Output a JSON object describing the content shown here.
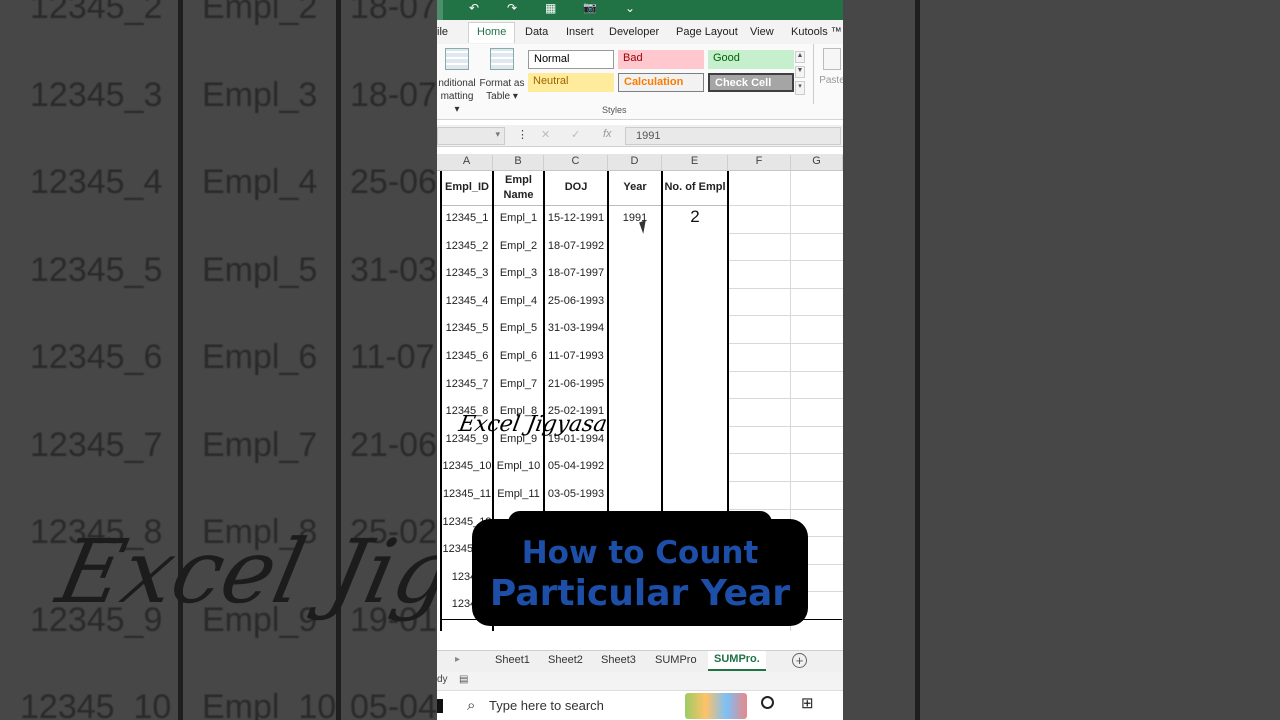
{
  "qat": {
    "undo": "↶",
    "redo": "↷",
    "table": "▦",
    "camera": "📷",
    "more": "⌄"
  },
  "ribbon_tabs": [
    "ile",
    "Home",
    "Data",
    "Insert",
    "Developer",
    "Page Layout",
    "View",
    "Kutools ™"
  ],
  "ribbon": {
    "conditional_1": "nditional",
    "conditional_2": "matting ▾",
    "format_table_1": "Format as",
    "format_table_2": "Table ▾",
    "styles": [
      {
        "label": "Normal",
        "color": "#000000",
        "bg": "#ffffff"
      },
      {
        "label": "Bad",
        "color": "#9c0006",
        "bg": "#ffc7ce"
      },
      {
        "label": "Good",
        "color": "#006100",
        "bg": "#c6efce"
      },
      {
        "label": "Neutral",
        "color": "#9c6500",
        "bg": "#ffeb9c"
      },
      {
        "label": "Calculation",
        "color": "#fa7d00",
        "bg": "#f2f2f2"
      },
      {
        "label": "Check Cell",
        "color": "#ffffff",
        "bg": "#a5a5a5"
      }
    ],
    "styles_group_label": "Styles",
    "paste_label": "Paste"
  },
  "formula_bar": {
    "fx": "fx",
    "cancel": "✕",
    "enter": "✓",
    "value": "1991"
  },
  "columns": [
    "A",
    "B",
    "C",
    "D",
    "E",
    "F",
    "G"
  ],
  "table": {
    "headers": [
      "Empl_ID",
      "Empl\nName",
      "DOJ",
      "Year",
      "No. of Empl"
    ],
    "header_b_line1": "Empl",
    "header_b_line2": "Name",
    "rows": [
      [
        "12345_1",
        "Empl_1",
        "15-12-1991",
        "1991",
        "2"
      ],
      [
        "12345_2",
        "Empl_2",
        "18-07-1992",
        "",
        ""
      ],
      [
        "12345_3",
        "Empl_3",
        "18-07-1997",
        "",
        ""
      ],
      [
        "12345_4",
        "Empl_4",
        "25-06-1993",
        "",
        ""
      ],
      [
        "12345_5",
        "Empl_5",
        "31-03-1994",
        "",
        ""
      ],
      [
        "12345_6",
        "Empl_6",
        "11-07-1993",
        "",
        ""
      ],
      [
        "12345_7",
        "Empl_7",
        "21-06-1995",
        "",
        ""
      ],
      [
        "12345_8",
        "Empl_8",
        "25-02-1991",
        "",
        ""
      ],
      [
        "12345_9",
        "Empl_9",
        "19-01-1994",
        "",
        ""
      ],
      [
        "12345_10",
        "Empl_10",
        "05-04-1992",
        "",
        ""
      ],
      [
        "12345_11",
        "Empl_11",
        "03-05-1993",
        "",
        ""
      ],
      [
        "12345_12",
        "Em",
        "",
        "",
        ""
      ],
      [
        "12345_13",
        "",
        "",
        "",
        ""
      ],
      [
        "12345",
        "",
        "",
        "",
        ""
      ],
      [
        "12345",
        "",
        "",
        "",
        ""
      ]
    ]
  },
  "watermark": "Excel Jigyasa",
  "banner": {
    "line1": "How to Count",
    "line2": "Particular Year"
  },
  "sheets": [
    "Sheet1",
    "Sheet2",
    "Sheet3",
    "SUMPro",
    "SUMPro."
  ],
  "active_sheet": "SUMPro.",
  "status_text": "dy",
  "taskbar": {
    "search_placeholder": "Type here to search"
  },
  "background": {
    "ids": [
      "12345_2",
      "12345_3",
      "12345_4",
      "12345_5",
      "12345_6",
      "12345_7",
      "12345_8",
      "12345_9",
      "12345_10"
    ],
    "names": [
      "Empl_2",
      "Empl_3",
      "Empl_4",
      "Empl_5",
      "Empl_6",
      "Empl_7",
      "Empl_8",
      "Empl_9",
      "Empl_10"
    ],
    "dates": [
      "18-07",
      "18-07",
      "25-06",
      "31-03",
      "11-07",
      "21-06",
      "25-02",
      "19-01",
      "05-04"
    ]
  }
}
